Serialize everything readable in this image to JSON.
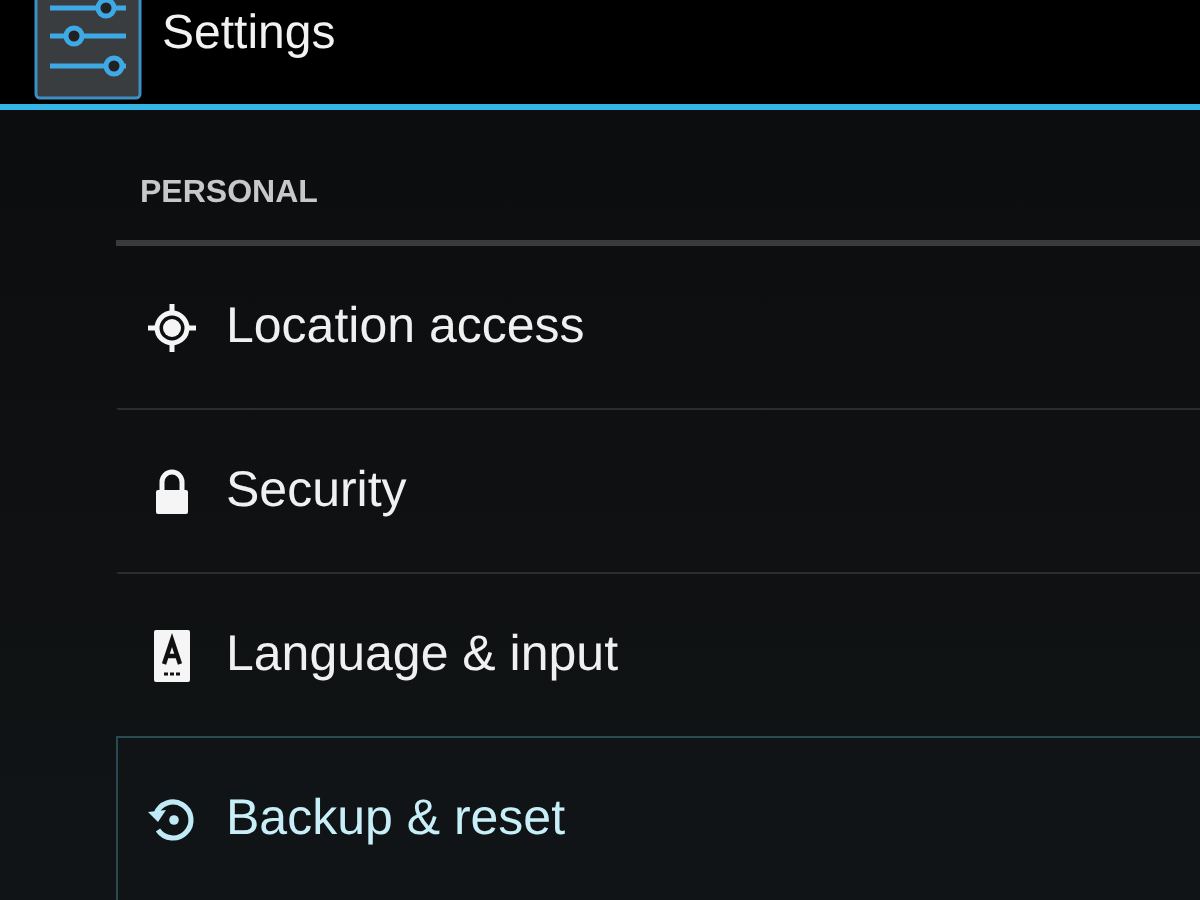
{
  "header": {
    "title": "Settings"
  },
  "section": {
    "title": "PERSONAL"
  },
  "items": [
    {
      "label": "Location access",
      "kind": "location",
      "selected": false
    },
    {
      "label": "Security",
      "kind": "lock",
      "selected": false
    },
    {
      "label": "Language & input",
      "kind": "keyboard",
      "selected": false
    },
    {
      "label": "Backup & reset",
      "kind": "backup",
      "selected": true
    }
  ]
}
